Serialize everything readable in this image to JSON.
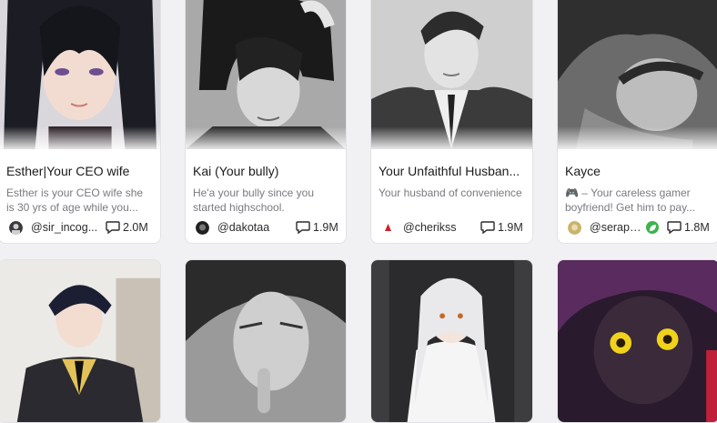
{
  "cards_row1": [
    {
      "title": "Esther|Your CEO wife",
      "description": "Esther is your CEO wife she is 30 yrs of age while you...",
      "author": "@sir_incog...",
      "chats": "2.0M"
    },
    {
      "title": "Kai (Your bully)",
      "description": "He'a your bully since you started highschool.",
      "author": "@dakotaa",
      "chats": "1.9M"
    },
    {
      "title": "Your Unfaithful Husban...",
      "description": "Your husband of convenience",
      "author": "@cherikss",
      "chats": "1.9M"
    },
    {
      "title": "Kayce",
      "description": "🎮 – Your careless gamer boyfriend! Get him to pay...",
      "author": "@seraph...",
      "chats": "1.8M"
    }
  ],
  "icons": {
    "chat": "chat-bubble-icon",
    "badge": "leaf-badge-icon"
  },
  "colors": {
    "background": "#f1f1f3",
    "card": "#ffffff",
    "title": "#1b1b1d",
    "description": "#7a7a80",
    "badge": "#3cb44a"
  }
}
